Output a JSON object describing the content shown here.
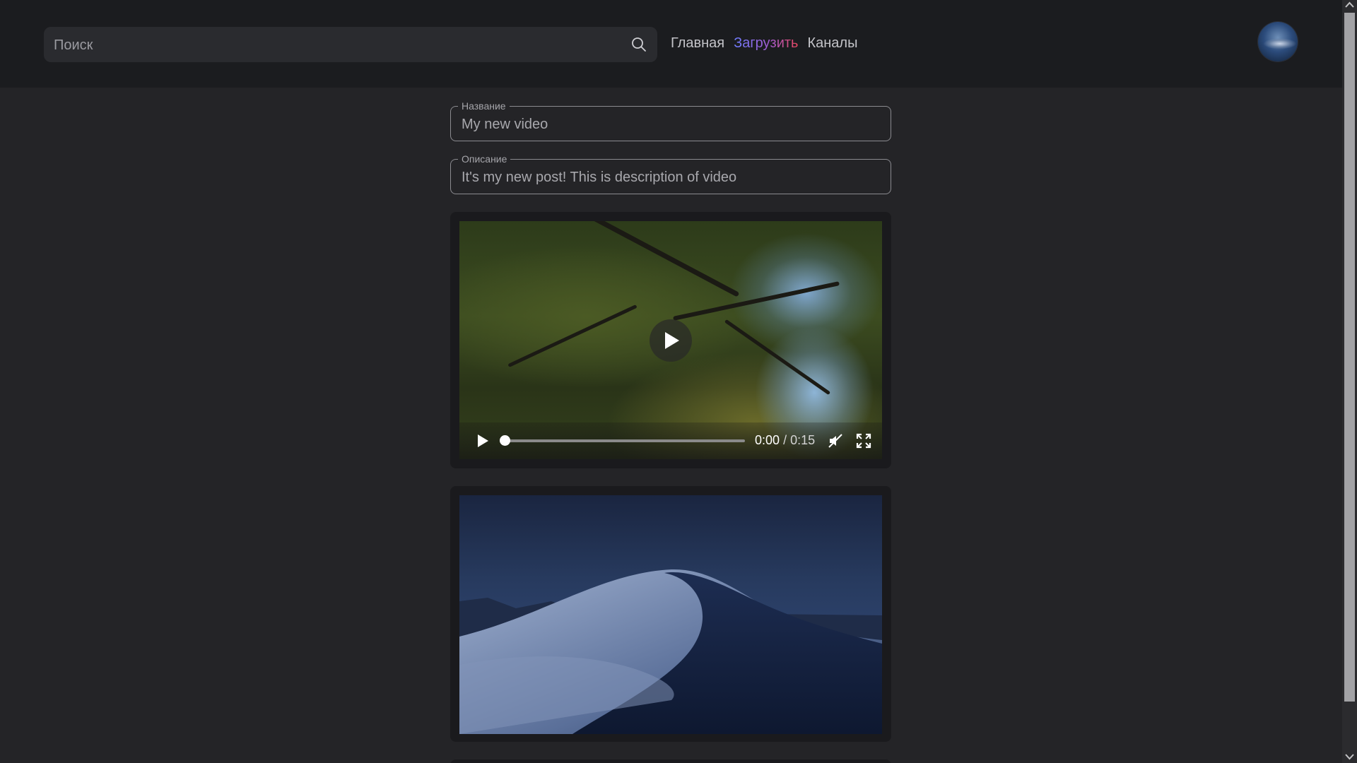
{
  "header": {
    "search": {
      "placeholder": "Поиск",
      "value": ""
    },
    "nav": [
      {
        "label": "Главная",
        "active": false
      },
      {
        "label": "Загрузить",
        "active": true
      },
      {
        "label": "Каналы",
        "active": false
      }
    ]
  },
  "form": {
    "title": {
      "label": "Название",
      "value": "My new video"
    },
    "description": {
      "label": "Описание",
      "value": "It's my new post! This is description of video"
    }
  },
  "video": {
    "current_time": "0:00",
    "separator": "/",
    "duration": "0:15",
    "progress": 0,
    "muted": true
  },
  "image": {
    "icon": "image-icon"
  },
  "colors": {
    "background": "#242427",
    "header": "#1b1c1f",
    "accent_gradient": [
      "#6f7dff",
      "#a05bd0",
      "#e8465f"
    ]
  }
}
